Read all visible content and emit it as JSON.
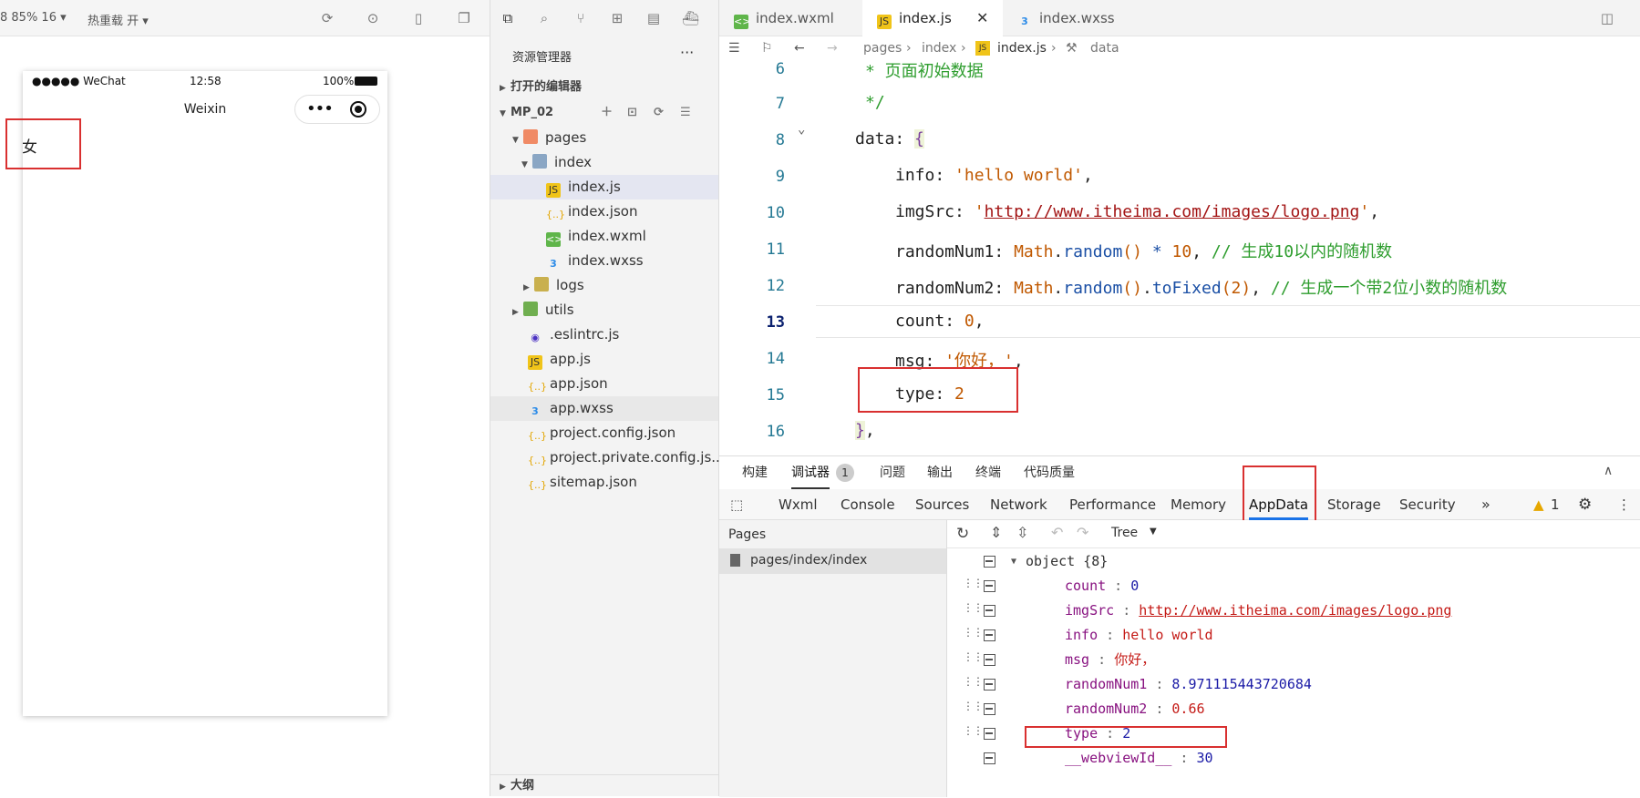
{
  "simulator": {
    "toolbar": {
      "zoom": "8 85% 16 ▾",
      "hotreload": "热重载 开 ▾"
    },
    "status": {
      "carrier": "●●●●● WeChat",
      "time": "12:58",
      "battery": "100%"
    },
    "nav_title": "Weixin",
    "content_text": "女"
  },
  "explorer": {
    "title": "资源管理器",
    "more": "···",
    "open_editors": "打开的编辑器",
    "project": "MP_02",
    "outline": "大纲",
    "tree": [
      {
        "label": "pages",
        "icon": "folder-icon"
      },
      {
        "label": "index",
        "icon": "folder-open-icon"
      },
      {
        "label": "index.js",
        "icon": "js-file-icon"
      },
      {
        "label": "index.json",
        "icon": "json-file-icon"
      },
      {
        "label": "index.wxml",
        "icon": "wxml-file-icon"
      },
      {
        "label": "index.wxss",
        "icon": "wxss-file-icon"
      },
      {
        "label": "logs",
        "icon": "folder-icon"
      },
      {
        "label": "utils",
        "icon": "folder-icon"
      },
      {
        "label": ".eslintrc.js",
        "icon": "eslint-file-icon"
      },
      {
        "label": "app.js",
        "icon": "js-file-icon"
      },
      {
        "label": "app.json",
        "icon": "json-file-icon"
      },
      {
        "label": "app.wxss",
        "icon": "wxss-file-icon"
      },
      {
        "label": "project.config.json",
        "icon": "json-file-icon"
      },
      {
        "label": "project.private.config.js...",
        "icon": "json-file-icon"
      },
      {
        "label": "sitemap.json",
        "icon": "json-file-icon"
      }
    ]
  },
  "editor": {
    "tabs": [
      "index.wxml",
      "index.js",
      "index.wxss"
    ],
    "breadcrumb": [
      "pages",
      "index",
      "index.js",
      "data"
    ],
    "lines": [
      "6",
      "7",
      "8",
      "9",
      "10",
      "11",
      "12",
      "13",
      "14",
      "15",
      "16"
    ],
    "code": {
      "l6": "* 页面初始数据",
      "l7": "*/",
      "l8_key": "data",
      "l9_key": "info",
      "l9_val": "'hello world'",
      "l10_key": "imgSrc",
      "l10_val": "http://www.itheima.com/images/logo.png",
      "l11_key": "randomNum1",
      "l11_obj": "Math",
      "l11_fn": "random",
      "l11_num": "10",
      "l11_cmt": "// 生成10以内的随机数",
      "l12_key": "randomNum2",
      "l12_obj": "Math",
      "l12_fn": "random",
      "l12_fn2": "toFixed",
      "l12_num": "2",
      "l12_cmt": "// 生成一个带2位小数的随机数",
      "l13_key": "count",
      "l13_val": "0",
      "l14_key": "msg",
      "l14_val": "'你好，'",
      "l15_key": "type",
      "l15_val": "2"
    }
  },
  "devtools": {
    "top_tabs": [
      "构建",
      "调试器",
      "问题",
      "输出",
      "终端",
      "代码质量"
    ],
    "debugger_badge": "1",
    "tabs": [
      "Wxml",
      "Console",
      "Sources",
      "Network",
      "Performance",
      "Memory",
      "AppData",
      "Storage",
      "Security"
    ],
    "warn_count": "1",
    "pages_title": "Pages",
    "page_item": "pages/index/index",
    "view_mode": "Tree",
    "object_label": "object {8}",
    "entries": [
      {
        "key": "count",
        "value": "0"
      },
      {
        "key": "imgSrc",
        "value": "http://www.itheima.com/images/logo.png"
      },
      {
        "key": "info",
        "value": "hello world"
      },
      {
        "key": "msg",
        "value": "你好，"
      },
      {
        "key": "randomNum1",
        "value": "8.971115443720684"
      },
      {
        "key": "randomNum2",
        "value": "0.66"
      },
      {
        "key": "type",
        "value": "2"
      },
      {
        "key": "__webviewId__",
        "value": "30"
      }
    ]
  }
}
